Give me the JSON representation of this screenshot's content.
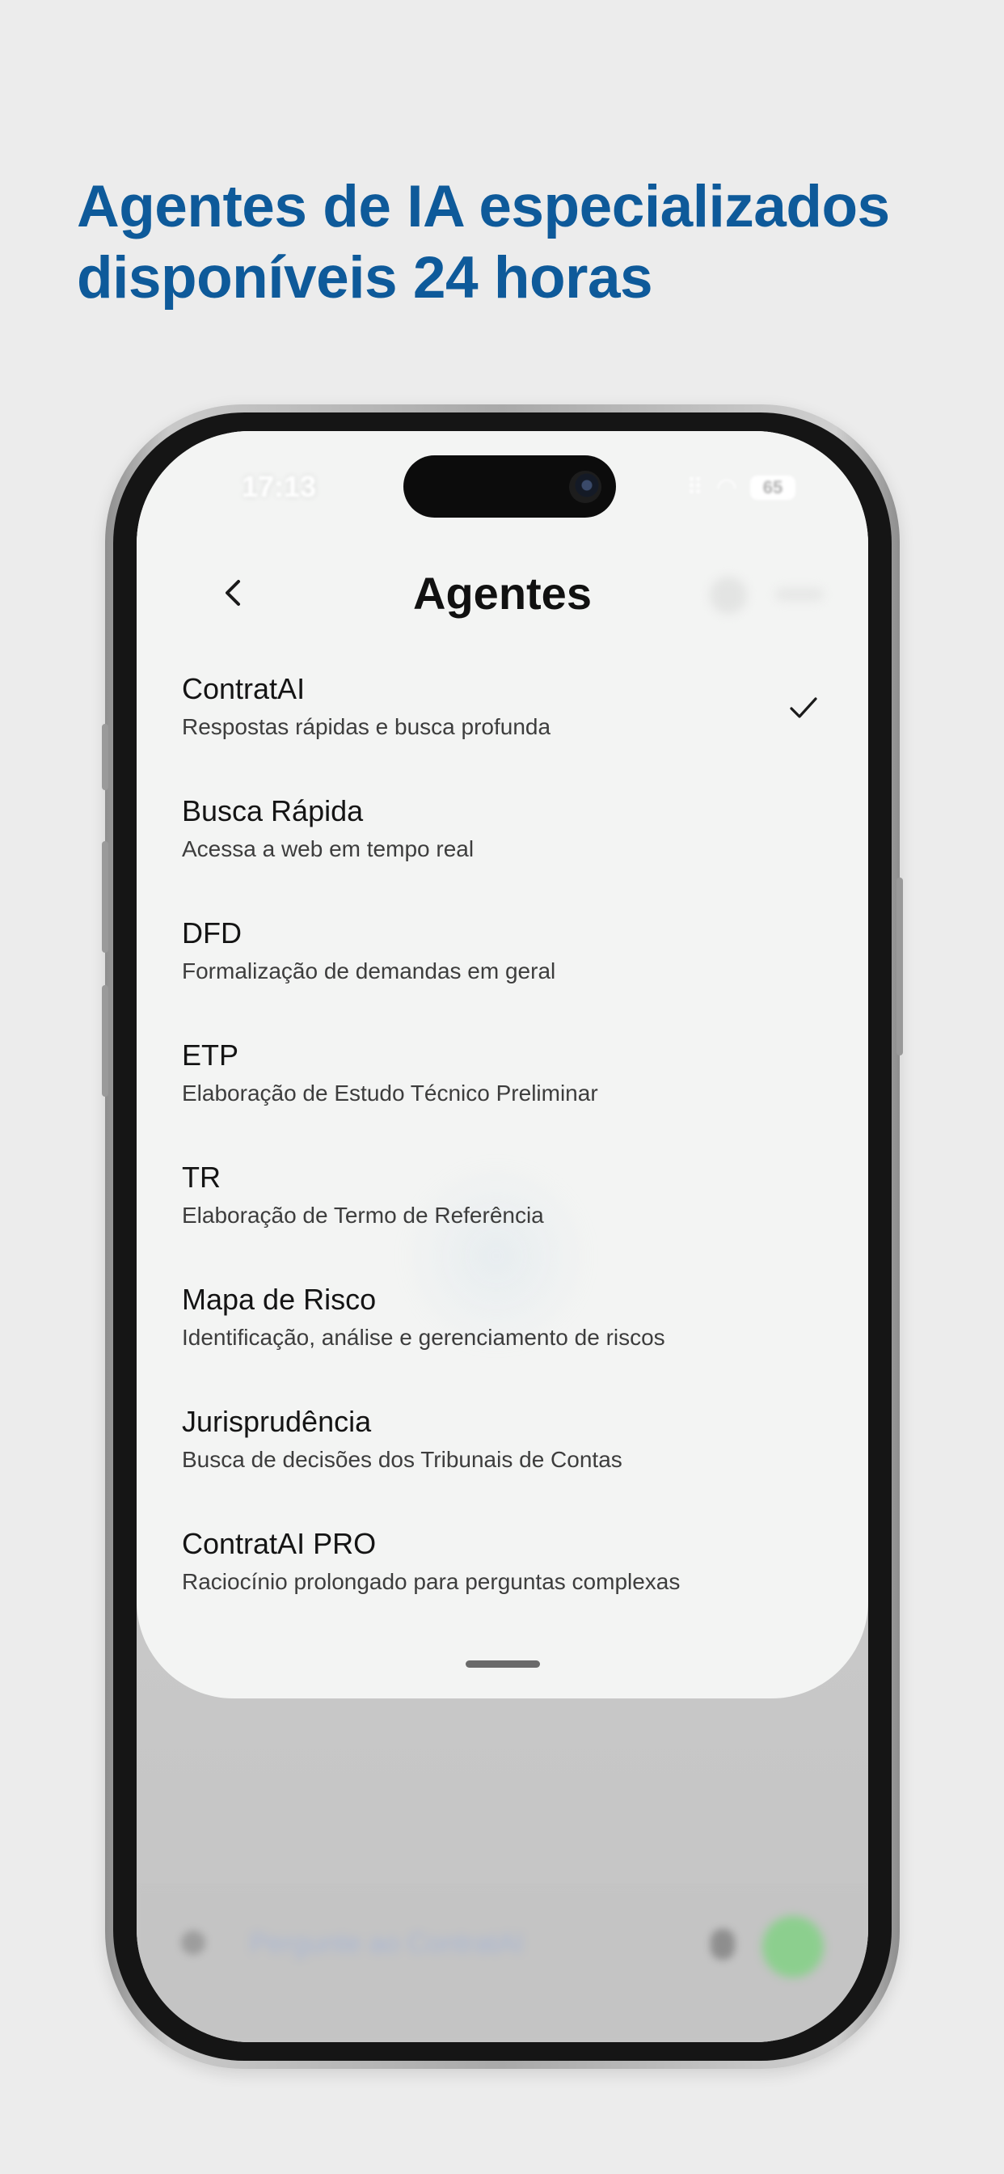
{
  "headline": {
    "line1": "Agentes de IA especializados",
    "line2": "disponíveis 24 horas"
  },
  "status_bar": {
    "time": "17:13",
    "battery": "65"
  },
  "nav": {
    "title": "Agentes"
  },
  "agents": [
    {
      "name": "ContratAI",
      "description": "Respostas rápidas e busca profunda",
      "selected": true
    },
    {
      "name": "Busca Rápida",
      "description": "Acessa a web em tempo real",
      "selected": false
    },
    {
      "name": "DFD",
      "description": "Formalização de demandas em geral",
      "selected": false
    },
    {
      "name": "ETP",
      "description": "Elaboração de Estudo Técnico Preliminar",
      "selected": false
    },
    {
      "name": "TR",
      "description": "Elaboração de Termo de Referência",
      "selected": false
    },
    {
      "name": "Mapa de Risco",
      "description": "Identificação, análise e gerenciamento de riscos",
      "selected": false
    },
    {
      "name": "Jurisprudência",
      "description": "Busca de decisões dos Tribunais de Contas",
      "selected": false
    },
    {
      "name": "ContratAI PRO",
      "description": "Raciocínio prolongado para perguntas complexas",
      "selected": false
    }
  ],
  "chat_input": {
    "placeholder": "Pergunte ao ContratAI"
  },
  "colors": {
    "headline": "#0e5a9a",
    "sheet": "#f3f4f3",
    "send_button": "#8ccf8e"
  }
}
